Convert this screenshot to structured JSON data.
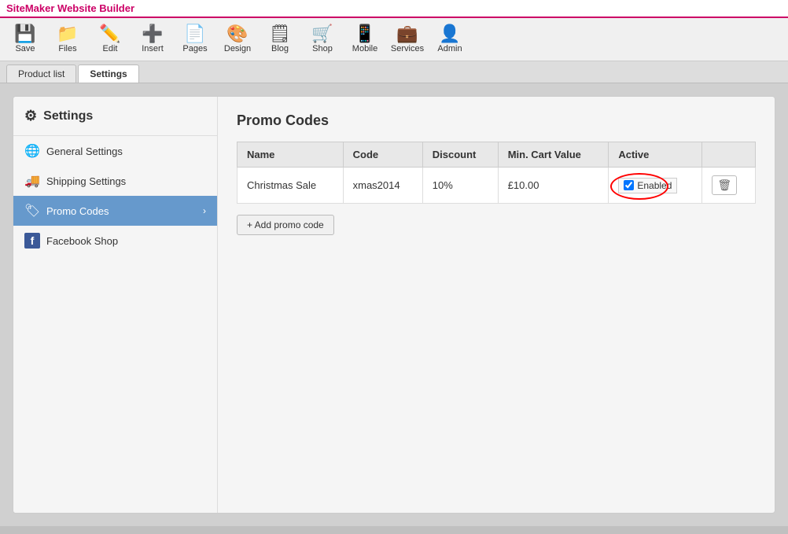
{
  "app": {
    "title": "SiteMaker Website Builder"
  },
  "toolbar": {
    "buttons": [
      {
        "id": "save",
        "label": "Save",
        "icon": "💾"
      },
      {
        "id": "files",
        "label": "Files",
        "icon": "📁"
      },
      {
        "id": "edit",
        "label": "Edit",
        "icon": "✏️"
      },
      {
        "id": "insert",
        "label": "Insert",
        "icon": "➕"
      },
      {
        "id": "pages",
        "label": "Pages",
        "icon": "📄"
      },
      {
        "id": "design",
        "label": "Design",
        "icon": "🎨"
      },
      {
        "id": "blog",
        "label": "Blog",
        "icon": "🗒"
      },
      {
        "id": "shop",
        "label": "Shop",
        "icon": "🛒"
      },
      {
        "id": "mobile",
        "label": "Mobile",
        "icon": "📱"
      },
      {
        "id": "services",
        "label": "Services",
        "icon": "💼"
      },
      {
        "id": "admin",
        "label": "Admin",
        "icon": "👤"
      }
    ]
  },
  "tabs": [
    {
      "id": "product-list",
      "label": "Product list",
      "active": false
    },
    {
      "id": "settings",
      "label": "Settings",
      "active": true
    }
  ],
  "sidebar": {
    "title": "Settings",
    "items": [
      {
        "id": "general-settings",
        "label": "General Settings",
        "icon": "general",
        "active": false
      },
      {
        "id": "shipping-settings",
        "label": "Shipping Settings",
        "icon": "shipping",
        "active": false
      },
      {
        "id": "promo-codes",
        "label": "Promo Codes",
        "icon": "promo",
        "active": true
      },
      {
        "id": "facebook-shop",
        "label": "Facebook Shop",
        "icon": "facebook",
        "active": false
      }
    ]
  },
  "content": {
    "section_title": "Promo Codes",
    "table": {
      "headers": [
        "Name",
        "Code",
        "Discount",
        "Min. Cart Value",
        "Active",
        ""
      ],
      "rows": [
        {
          "name": "Christmas Sale",
          "code": "xmas2014",
          "discount": "10%",
          "min_cart_value": "£10.00",
          "active_label": "Enabled",
          "active_checked": true
        }
      ]
    },
    "add_button_label": "+ Add promo code"
  }
}
